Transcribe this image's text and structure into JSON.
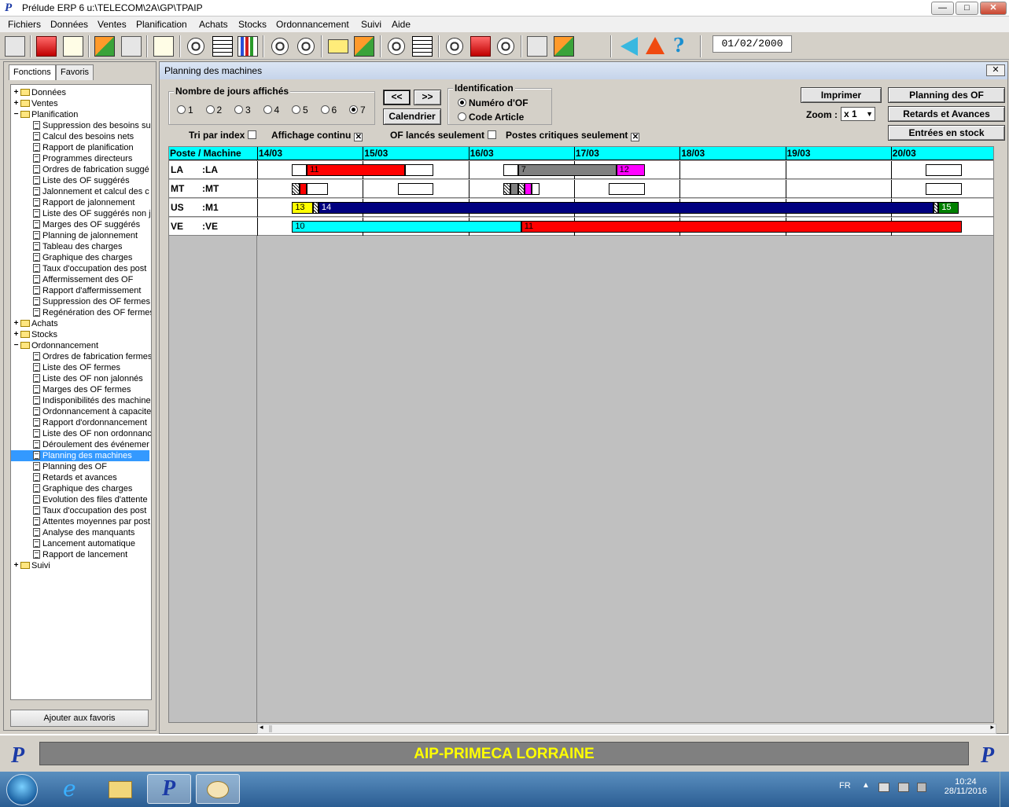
{
  "app": {
    "title": "Prélude ERP 6  u:\\TELECOM\\2A\\GP\\TPAIP",
    "window_buttons": [
      "—",
      "□",
      "✕"
    ]
  },
  "menu": [
    "Fichiers",
    "Données",
    "Ventes",
    "Planification",
    "Achats",
    "Stocks",
    "Ordonnancement",
    "Suivi",
    "Aide"
  ],
  "toolbar": {
    "date": "01/02/2000"
  },
  "left_panel": {
    "tabs": [
      "Fonctions",
      "Favoris"
    ],
    "tree": [
      {
        "label": "Données",
        "level": 0,
        "expander": "+"
      },
      {
        "label": "Ventes",
        "level": 0,
        "expander": "+"
      },
      {
        "label": "Planification",
        "level": 0,
        "expander": "−"
      },
      {
        "label": "Suppression des besoins su",
        "level": 1
      },
      {
        "label": "Calcul des besoins nets",
        "level": 1
      },
      {
        "label": "Rapport de planification",
        "level": 1
      },
      {
        "label": "Programmes directeurs",
        "level": 1
      },
      {
        "label": "Ordres de fabrication suggé",
        "level": 1
      },
      {
        "label": "Liste des OF suggérés",
        "level": 1
      },
      {
        "label": "Jalonnement et calcul des c",
        "level": 1
      },
      {
        "label": "Rapport de jalonnement",
        "level": 1
      },
      {
        "label": "Liste des OF suggérés non j",
        "level": 1
      },
      {
        "label": "Marges des OF suggérés",
        "level": 1
      },
      {
        "label": "Planning de jalonnement",
        "level": 1
      },
      {
        "label": "Tableau des charges",
        "level": 1
      },
      {
        "label": "Graphique des charges",
        "level": 1
      },
      {
        "label": "Taux d'occupation des post",
        "level": 1
      },
      {
        "label": "Affermissement des OF",
        "level": 1
      },
      {
        "label": "Rapport d'affermissement",
        "level": 1
      },
      {
        "label": "Suppression des OF fermes",
        "level": 1
      },
      {
        "label": "Regénération des OF fermes",
        "level": 1
      },
      {
        "label": "Achats",
        "level": 0,
        "expander": "+"
      },
      {
        "label": "Stocks",
        "level": 0,
        "expander": "+"
      },
      {
        "label": "Ordonnancement",
        "level": 0,
        "expander": "−"
      },
      {
        "label": "Ordres de fabrication fermes",
        "level": 1
      },
      {
        "label": "Liste des OF fermes",
        "level": 1
      },
      {
        "label": "Liste des OF non jalonnés",
        "level": 1
      },
      {
        "label": "Marges des OF fermes",
        "level": 1
      },
      {
        "label": "Indisponibilités des machine",
        "level": 1
      },
      {
        "label": "Ordonnancement à capacite",
        "level": 1
      },
      {
        "label": "Rapport d'ordonnancement",
        "level": 1
      },
      {
        "label": "Liste des OF non ordonnanc",
        "level": 1
      },
      {
        "label": "Déroulement des événemer",
        "level": 1
      },
      {
        "label": "Planning des machines",
        "level": 1,
        "selected": true
      },
      {
        "label": "Planning des OF",
        "level": 1
      },
      {
        "label": "Retards et avances",
        "level": 1
      },
      {
        "label": "Graphique des charges",
        "level": 1
      },
      {
        "label": "Evolution des files d'attente",
        "level": 1
      },
      {
        "label": "Taux d'occupation des post",
        "level": 1
      },
      {
        "label": "Attentes moyennes par post",
        "level": 1
      },
      {
        "label": "Analyse des manquants",
        "level": 1
      },
      {
        "label": "Lancement automatique",
        "level": 1
      },
      {
        "label": "Rapport de lancement",
        "level": 1
      },
      {
        "label": "Suivi",
        "level": 0,
        "expander": "+"
      }
    ],
    "add_favorites": "Ajouter aux favoris"
  },
  "main": {
    "title": "Planning des machines",
    "close": "✕",
    "days_group": {
      "label": "Nombre de jours affichés",
      "options": [
        "1",
        "2",
        "3",
        "4",
        "5",
        "6",
        "7"
      ],
      "selected": "7"
    },
    "nav": {
      "prev": "<<",
      "next": ">>",
      "calendar": "Calendrier"
    },
    "ident_group": {
      "label": "Identification",
      "options": [
        "Numéro d'OF",
        "Code Article"
      ],
      "selected": "Numéro d'OF"
    },
    "checks": [
      {
        "label": "Tri par index",
        "checked": false
      },
      {
        "label": "Affichage continu",
        "checked": true
      },
      {
        "label": "OF lancés seulement",
        "checked": false
      },
      {
        "label": "Postes critiques seulement",
        "checked": true
      }
    ],
    "buttons": {
      "print": "Imprimer",
      "planning_of": "Planning des OF",
      "late_early": "Retards et Avances",
      "stock_entries": "Entrées en stock"
    },
    "zoom": {
      "label": "Zoom :",
      "value": "x 1"
    },
    "gantt": {
      "header": "Poste / Machine",
      "days": [
        "14/03",
        "15/03",
        "16/03",
        "17/03",
        "18/03",
        "19/03",
        "20/03"
      ],
      "rows": [
        {
          "code": "LA",
          "machine": ":LA",
          "bars": [
            {
              "label": "",
              "start": 0.33,
              "end": 0.47,
              "color": "#ffffff"
            },
            {
              "label": "11",
              "start": 0.47,
              "end": 1.4,
              "color": "#ff0000"
            },
            {
              "label": "",
              "start": 1.4,
              "end": 1.67,
              "color": "#ffffff"
            },
            {
              "label": "",
              "start": 2.33,
              "end": 2.47,
              "color": "#ffffff"
            },
            {
              "label": "7",
              "start": 2.47,
              "end": 3.4,
              "color": "#808080"
            },
            {
              "label": "12",
              "start": 3.4,
              "end": 3.67,
              "color": "#ff00ff"
            },
            {
              "label": "",
              "start": 6.33,
              "end": 6.67,
              "color": "#ffffff"
            }
          ]
        },
        {
          "code": "MT",
          "machine": ":MT",
          "bars": [
            {
              "label": "",
              "start": 0.33,
              "end": 0.4,
              "color": "hatch"
            },
            {
              "label": "",
              "start": 0.4,
              "end": 0.47,
              "color": "#ff0000"
            },
            {
              "label": "",
              "start": 0.47,
              "end": 0.67,
              "color": "#ffffff"
            },
            {
              "label": "",
              "start": 1.33,
              "end": 1.67,
              "color": "#ffffff"
            },
            {
              "label": "",
              "start": 2.33,
              "end": 2.4,
              "color": "hatch"
            },
            {
              "label": "",
              "start": 2.4,
              "end": 2.47,
              "color": "#808080"
            },
            {
              "label": "",
              "start": 2.47,
              "end": 2.53,
              "color": "hatch"
            },
            {
              "label": "",
              "start": 2.53,
              "end": 2.6,
              "color": "#ff00ff"
            },
            {
              "label": "",
              "start": 2.6,
              "end": 2.67,
              "color": "#ffffff"
            },
            {
              "label": "",
              "start": 3.33,
              "end": 3.67,
              "color": "#ffffff"
            },
            {
              "label": "",
              "start": 6.33,
              "end": 6.67,
              "color": "#ffffff"
            }
          ]
        },
        {
          "code": "US",
          "machine": ":M1",
          "bars": [
            {
              "label": "13",
              "start": 0.33,
              "end": 0.53,
              "color": "#ffff00"
            },
            {
              "label": "",
              "start": 0.53,
              "end": 0.58,
              "color": "hatch"
            },
            {
              "label": "14",
              "start": 0.58,
              "end": 6.4,
              "color": "#000080",
              "text_color": "#ffffff"
            },
            {
              "label": "",
              "start": 6.4,
              "end": 6.45,
              "color": "hatch"
            },
            {
              "label": "15",
              "start": 6.45,
              "end": 6.64,
              "color": "#008000",
              "text_color": "#ffffff"
            }
          ]
        },
        {
          "code": "VE",
          "machine": ":VE",
          "bars": [
            {
              "label": "10",
              "start": 0.33,
              "end": 2.5,
              "color": "#00ffff"
            },
            {
              "label": "11",
              "start": 2.5,
              "end": 6.67,
              "color": "#ff0000"
            }
          ]
        }
      ]
    }
  },
  "banner": {
    "text": "AIP-PRIMECA LORRAINE"
  },
  "taskbar": {
    "lang": "FR",
    "time": "10:24",
    "date": "28/11/2016"
  }
}
